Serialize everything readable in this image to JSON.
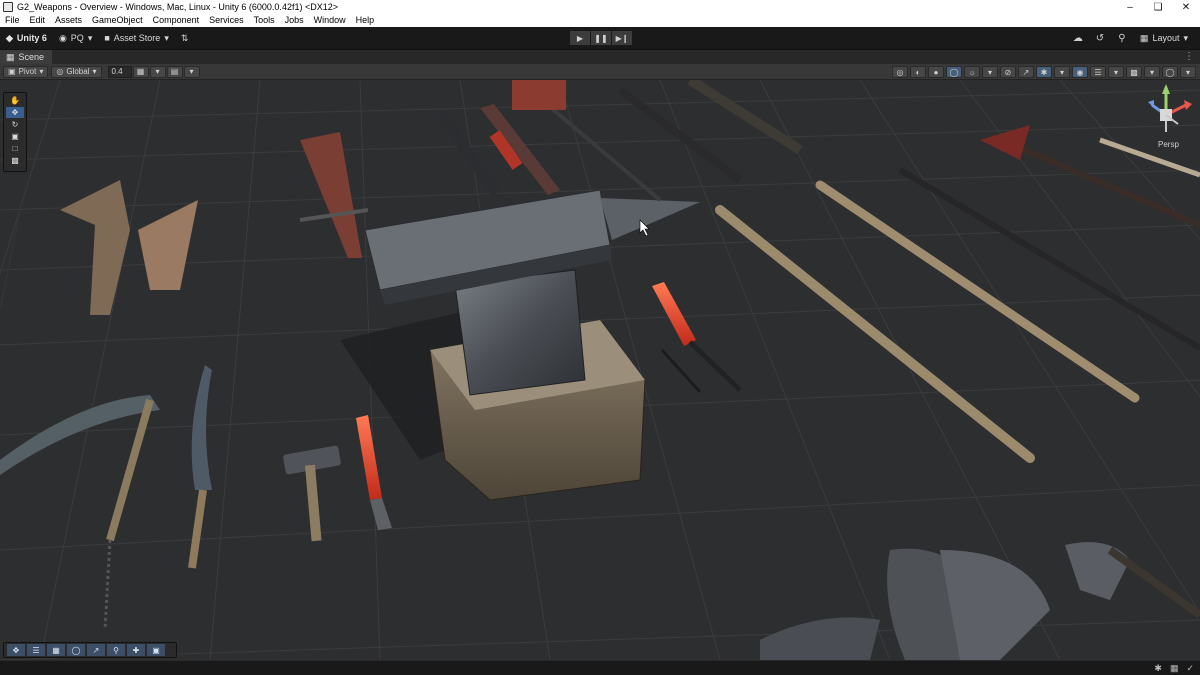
{
  "window": {
    "title": "G2_Weapons - Overview - Windows, Mac, Linux - Unity 6 (6000.0.42f1) <DX12>",
    "minimize": "–",
    "maximize": "❏",
    "close": "✕"
  },
  "menu": [
    "File",
    "Edit",
    "Assets",
    "GameObject",
    "Component",
    "Services",
    "Tools",
    "Jobs",
    "Window",
    "Help"
  ],
  "toolbar": {
    "unity_label": "Unity 6",
    "account_label": "PQ",
    "asset_store_label": "Asset Store",
    "layout_label": "Layout",
    "play_icons": [
      "▶",
      "❚❚",
      "▶❙"
    ]
  },
  "scene_tab": {
    "label": "Scene",
    "more": "⋮"
  },
  "scene_toolbar": {
    "pivot_label": "Pivot",
    "global_label": "Global",
    "snap_value": "0.4"
  },
  "viewport": {
    "camera_mode": "Persp",
    "background_color": "#2d2e30",
    "grid_color": "#3b3c3e"
  },
  "tools": [
    "hand-tool",
    "move-tool",
    "rotate-tool",
    "scale-tool",
    "rect-tool",
    "transform-tool"
  ],
  "overlay_tools": [
    "move",
    "layers",
    "grid",
    "orbit",
    "pivot",
    "search",
    "snap",
    "gizmo"
  ]
}
